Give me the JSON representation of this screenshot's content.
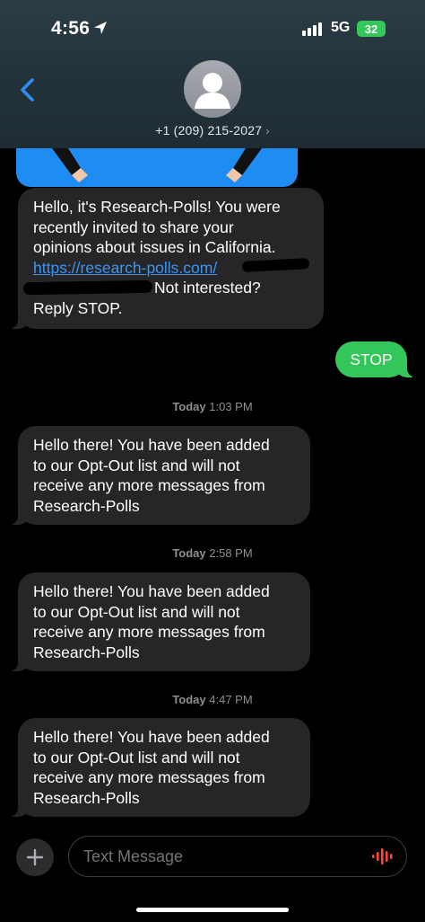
{
  "status_bar": {
    "time": "4:56",
    "network": "5G",
    "battery": "32"
  },
  "header": {
    "contact_number": "+1 (209) 215-2027",
    "chevron": "›"
  },
  "messages": [
    {
      "lines": [
        "Hello, it's Research-Polls! You were",
        "recently invited to share your",
        "opinions about issues in California."
      ],
      "link_text": "https://research-polls.com/",
      "after_link": "Not interested?",
      "last_line": "Reply STOP."
    }
  ],
  "sent_message": "STOP",
  "replies": [
    {
      "timestamp_day": "Today",
      "timestamp_time": "1:03 PM",
      "lines": [
        "Hello there! You have been added",
        "to our Opt-Out list and will not",
        "receive any more messages from",
        "Research-Polls"
      ]
    },
    {
      "timestamp_day": "Today",
      "timestamp_time": "2:58 PM",
      "lines": [
        "Hello there! You have been added",
        "to our Opt-Out list and will not",
        "receive any more messages from",
        "Research-Polls"
      ]
    },
    {
      "timestamp_day": "Today",
      "timestamp_time": "4:47 PM",
      "lines": [
        "Hello there! You have been added",
        "to our Opt-Out list and will not",
        "receive any more messages from",
        "Research-Polls"
      ]
    }
  ],
  "composer": {
    "placeholder": "Text Message",
    "plus_icon": "plus-icon",
    "audio_icon": "audio-waveform-icon"
  },
  "colors": {
    "incoming_bubble": "#262628",
    "outgoing_bubble": "#33c759",
    "link": "#3d95f2",
    "back": "#2f8cf5"
  }
}
